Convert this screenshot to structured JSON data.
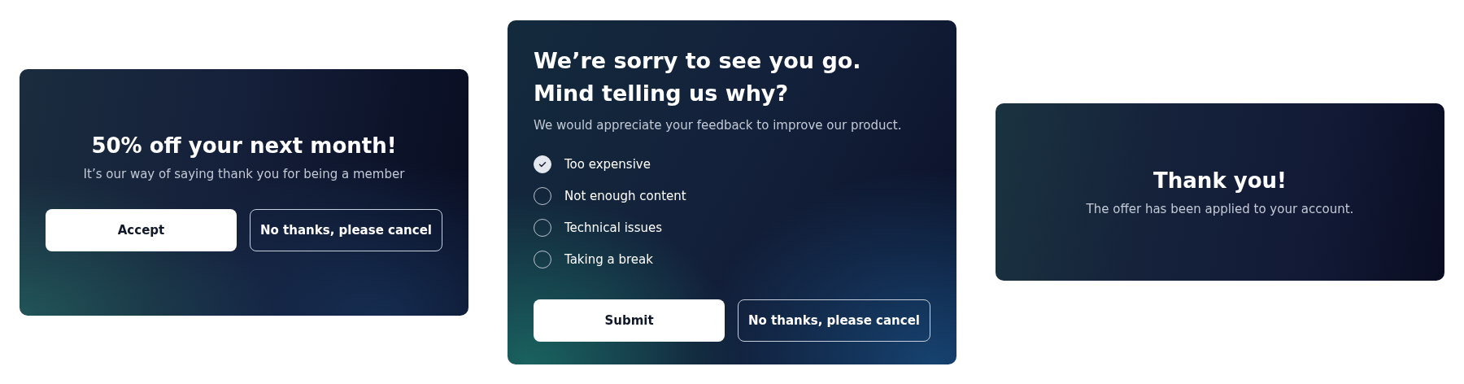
{
  "cards": [
    {
      "kind": "offer",
      "title": "50% off your next month!",
      "subtitle": "It’s our way of saying thank you for being a member",
      "buttons": [
        {
          "label": "Accept",
          "kind": "primary"
        },
        {
          "label": "No thanks, please cancel",
          "kind": "secondary"
        }
      ]
    },
    {
      "kind": "survey",
      "title_lines": [
        "We’re sorry to see you go.",
        "Mind telling us why?"
      ],
      "subtitle": "We would appreciate your feedback to improve our product.",
      "options": [
        {
          "label": "Too expensive",
          "checked": true
        },
        {
          "label": "Not enough content",
          "checked": false
        },
        {
          "label": "Technical issues",
          "checked": false
        },
        {
          "label": "Taking a break",
          "checked": false
        }
      ],
      "buttons": [
        {
          "label": "Submit",
          "kind": "primary"
        },
        {
          "label": "No thanks, please cancel",
          "kind": "secondary"
        }
      ]
    },
    {
      "kind": "confirmation",
      "title": "Thank you!",
      "subtitle": "The offer has been applied to your account."
    }
  ]
}
